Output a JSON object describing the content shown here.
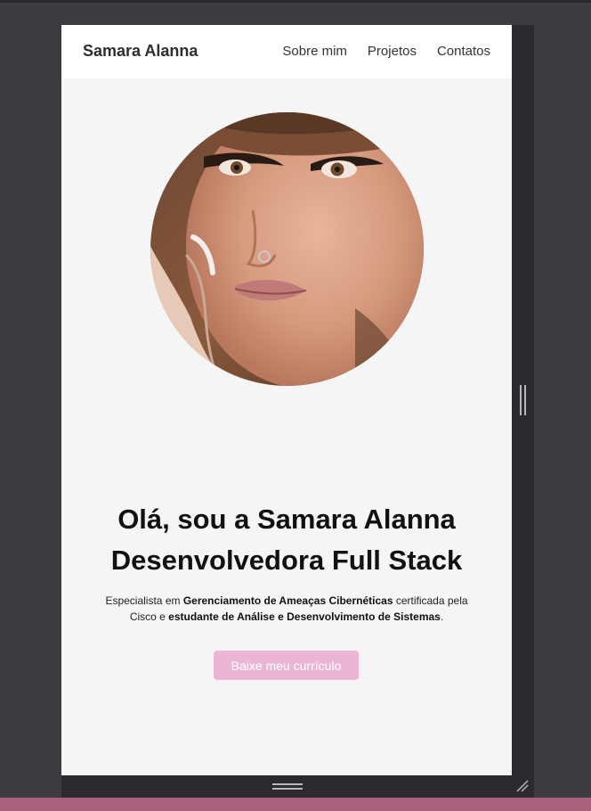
{
  "header": {
    "brand": "Samara Alanna",
    "nav": [
      {
        "label": "Sobre mim"
      },
      {
        "label": "Projetos"
      },
      {
        "label": "Contatos"
      }
    ]
  },
  "hero": {
    "headline_line1": "Olá, sou a Samara Alanna",
    "headline_line2": "Desenvolvedora Full Stack",
    "desc_part1": "Especialista em ",
    "desc_bold1": "Gerenciamento de Ameaças Cibernéticas",
    "desc_part2": " certificada pela Cisco e ",
    "desc_bold2": "estudante de Análise e Desenvolvimento de Sistemas",
    "desc_part3": ".",
    "cta_label": "Baixe meu currículo"
  },
  "colors": {
    "page_bg": "#f5f5f5",
    "nav_bg": "#ffffff",
    "cta_bg": "#eab6d3",
    "devtools_bg": "#3c3b40"
  }
}
